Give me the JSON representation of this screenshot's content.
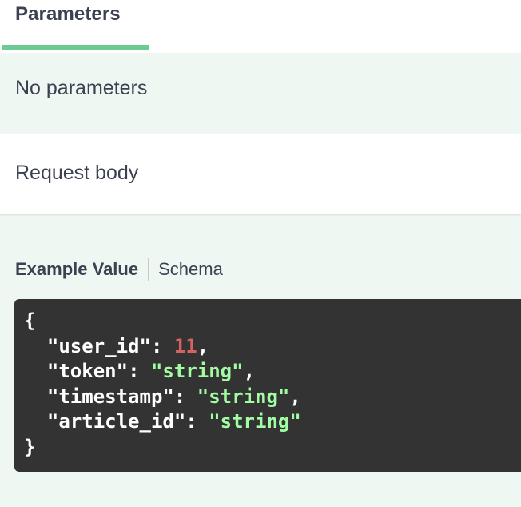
{
  "parameters": {
    "tab_label": "Parameters",
    "empty_message": "No parameters"
  },
  "request_body": {
    "title": "Request body",
    "tabs": {
      "example_value": "Example Value",
      "schema": "Schema"
    },
    "example": {
      "open_brace": "{",
      "close_brace": "}",
      "fields": [
        {
          "key": "\"user_id\"",
          "value": "11",
          "type": "number"
        },
        {
          "key": "\"token\"",
          "value": "\"string\"",
          "type": "string"
        },
        {
          "key": "\"timestamp\"",
          "value": "\"string\"",
          "type": "string"
        },
        {
          "key": "\"article_id\"",
          "value": "\"string\"",
          "type": "string"
        }
      ]
    }
  },
  "colors": {
    "accent": "#6bcb93",
    "code_background": "#333333",
    "number_token": "#d36363",
    "string_token": "#a2fca2",
    "text": "#3b4151"
  }
}
